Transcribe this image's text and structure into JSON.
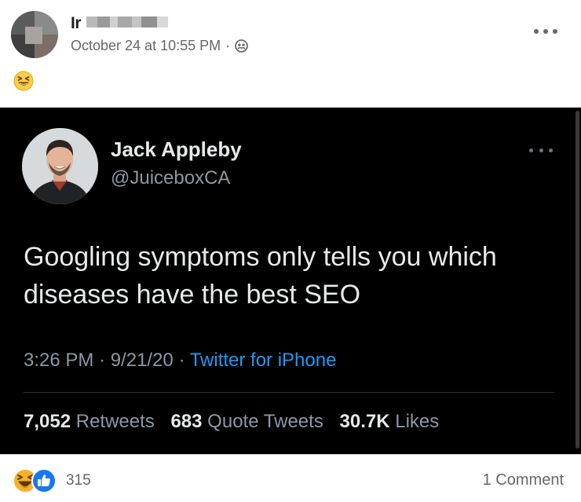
{
  "post": {
    "author_name_visible": "Ir",
    "timestamp": "October 24 at 10:55 PM",
    "separator": "·",
    "audience_icon": "friends-audience-icon",
    "more_icon": "more-options-icon",
    "text_emoji": "grinning-squinting-face-emoji"
  },
  "tweet": {
    "display_name": "Jack Appleby",
    "handle": "@JuiceboxCA",
    "text": "Googling symptoms only tells you which diseases have the best SEO",
    "time": "3:26 PM · 9/21/20 · ",
    "source": "Twitter for iPhone",
    "stats": {
      "retweets_count": "7,052",
      "retweets_label": "Retweets",
      "quotes_count": "683",
      "quotes_label": "Quote Tweets",
      "likes_count": "30.7K",
      "likes_label": "Likes"
    },
    "colors": {
      "background": "#000000",
      "text": "#e7e9ea",
      "secondary": "#8b98a5",
      "link": "#1d9bf0"
    }
  },
  "footer": {
    "reactions_count": "315",
    "reaction_icons": [
      "haha-reaction-icon",
      "like-reaction-icon"
    ],
    "comments_label": "1 Comment"
  },
  "colors": {
    "facebook_secondary_text": "#65676b",
    "like_blue": "#1877f2",
    "haha_yellow": "#f7b125"
  }
}
